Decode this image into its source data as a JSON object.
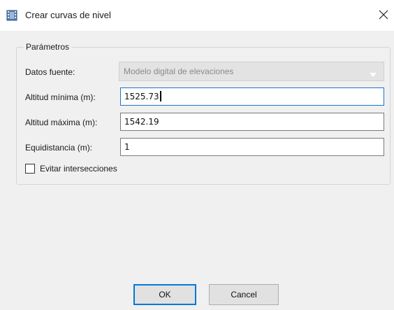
{
  "window": {
    "title": "Crear curvas de nivel",
    "icon": "film-strip-icon",
    "close_glyph": "✕"
  },
  "group": {
    "title": "Parámetros"
  },
  "fields": {
    "source_label": "Datos fuente:",
    "source_value": "Modelo digital de elevaciones",
    "min_label": "Altitud mínima (m):",
    "min_value": "1525.73",
    "max_label": "Altitud máxima (m):",
    "max_value": "1542.19",
    "equi_label": "Equidistancia (m):",
    "equi_value": "1"
  },
  "checkbox": {
    "label": "Evitar intersecciones",
    "checked": false
  },
  "buttons": {
    "ok_label": "OK",
    "cancel_label": "Cancel"
  },
  "colors": {
    "accent": "#0078d7",
    "focus_border": "#1a73d1",
    "dialog_bg": "#f0f0f0"
  }
}
